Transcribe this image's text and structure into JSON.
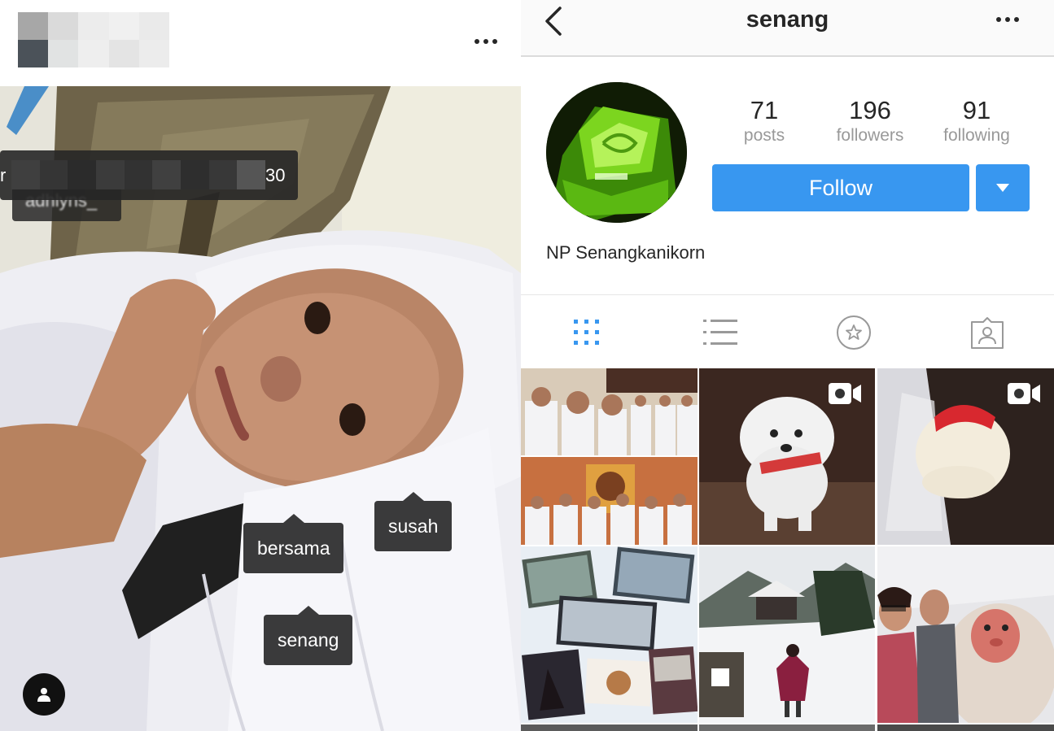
{
  "left_post": {
    "header_menu_icon": "ellipsis-icon",
    "blurred_tag_text": "adhlyns_",
    "blurred_tag_left_fragment": "r",
    "blurred_tag_right_fragment": "30",
    "tags": [
      {
        "text": "susah"
      },
      {
        "text": "bersama"
      },
      {
        "text": "senang"
      }
    ],
    "user_badge_icon": "user-icon"
  },
  "profile": {
    "nav": {
      "back_icon": "chevron-left-icon",
      "title": "senang",
      "menu_icon": "ellipsis-icon"
    },
    "stats": [
      {
        "value": "71",
        "label": "posts"
      },
      {
        "value": "196",
        "label": "followers"
      },
      {
        "value": "91",
        "label": "following"
      }
    ],
    "follow_label": "Follow",
    "dropdown_icon": "caret-down-icon",
    "full_name": "NP Senangkanikorn",
    "tabs": [
      {
        "name": "grid",
        "icon": "grid-icon",
        "active": true
      },
      {
        "name": "list",
        "icon": "list-icon",
        "active": false
      },
      {
        "name": "saved",
        "icon": "star-icon",
        "active": false
      },
      {
        "name": "tagged",
        "icon": "tagged-user-icon",
        "active": false
      }
    ],
    "colors": {
      "accent": "#3897f0",
      "active_tab": "#3897f0",
      "inactive_tab": "#999999"
    }
  }
}
